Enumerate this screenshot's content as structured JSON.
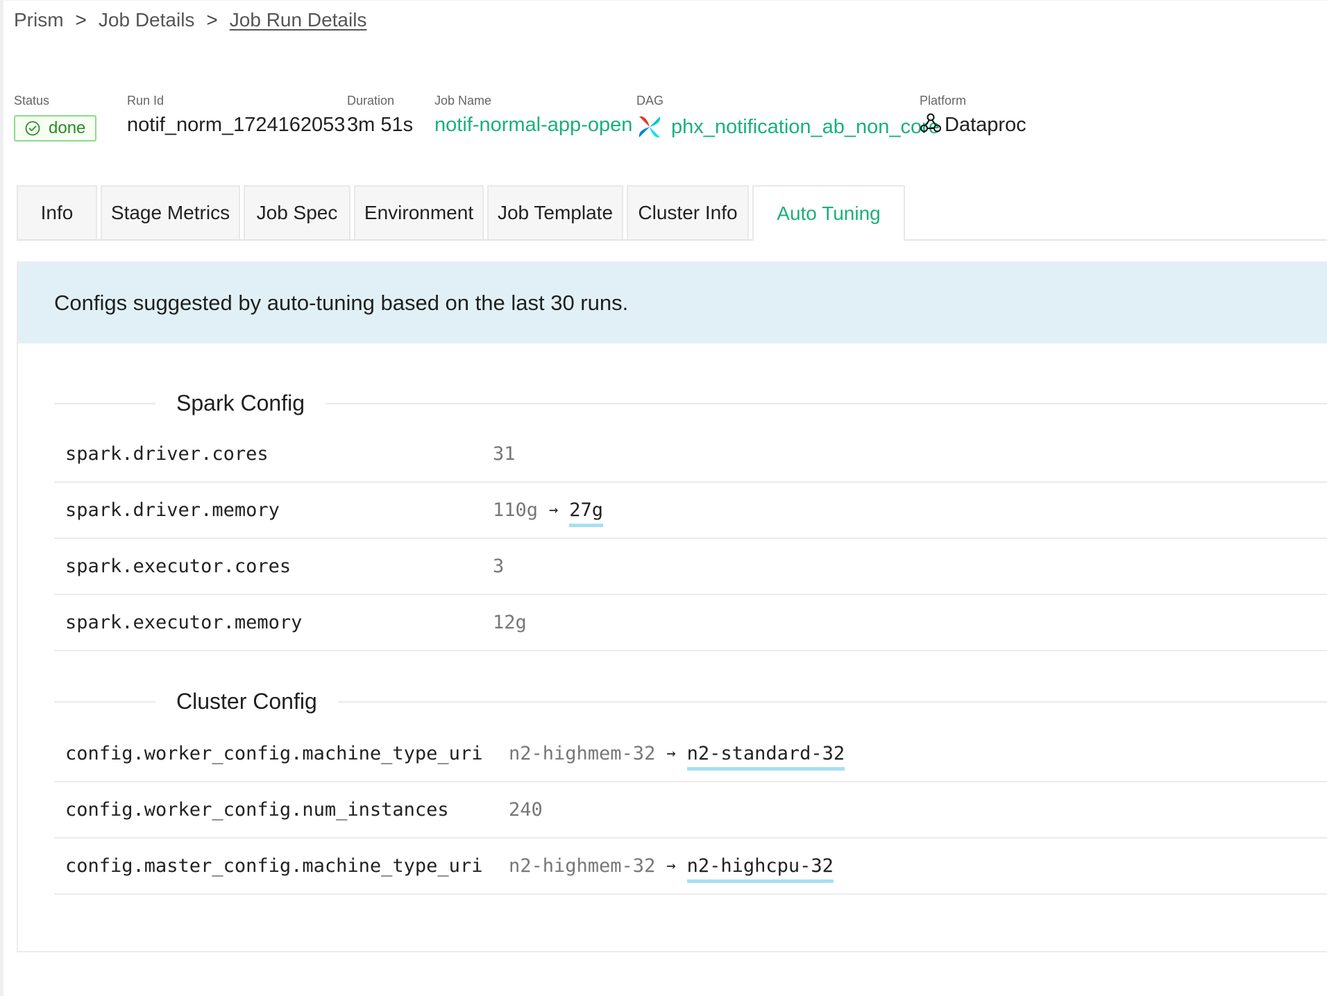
{
  "breadcrumb": {
    "items": [
      "Prism",
      "Job Details",
      "Job Run Details"
    ],
    "separator": ">"
  },
  "meta": {
    "status": {
      "label": "Status",
      "value": "done"
    },
    "run_id": {
      "label": "Run Id",
      "value": "notif_norm_1724162053"
    },
    "duration": {
      "label": "Duration",
      "value": "3m 51s"
    },
    "job_name": {
      "label": "Job Name",
      "value": "notif-normal-app-open"
    },
    "dag": {
      "label": "DAG",
      "value": "phx_notification_ab_non_core",
      "icon": "airflow-icon"
    },
    "platform": {
      "label": "Platform",
      "value": "Dataproc",
      "icon": "dataproc-icon"
    }
  },
  "tabs": [
    {
      "label": "Info"
    },
    {
      "label": "Stage Metrics"
    },
    {
      "label": "Job Spec"
    },
    {
      "label": "Environment"
    },
    {
      "label": "Job Template"
    },
    {
      "label": "Cluster Info"
    },
    {
      "label": "Auto Tuning",
      "active": true
    }
  ],
  "auto_tuning": {
    "banner": "Configs suggested by auto-tuning based on the last 30 runs.",
    "spark_config": {
      "title": "Spark Config",
      "rows": [
        {
          "key": "spark.driver.cores",
          "value": "31"
        },
        {
          "key": "spark.driver.memory",
          "value": "110g",
          "new_value": "27g"
        },
        {
          "key": "spark.executor.cores",
          "value": "3"
        },
        {
          "key": "spark.executor.memory",
          "value": "12g"
        }
      ]
    },
    "cluster_config": {
      "title": "Cluster Config",
      "rows": [
        {
          "key": "config.worker_config.machine_type_uri",
          "value": "n2-highmem-32",
          "new_value": "n2-standard-32"
        },
        {
          "key": "config.worker_config.num_instances",
          "value": "240"
        },
        {
          "key": "config.master_config.machine_type_uri",
          "value": "n2-highmem-32",
          "new_value": "n2-highcpu-32"
        }
      ]
    },
    "arrow": "→"
  },
  "colors": {
    "accent": "#1ab07a",
    "banner_bg": "#e1f0f6",
    "status_border": "#8fd88f",
    "change_underline": "#a6dff2"
  }
}
